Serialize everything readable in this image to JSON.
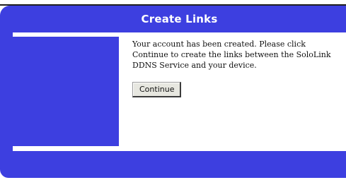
{
  "header": {
    "title": "Create Links"
  },
  "main": {
    "message": "Your account has been created. Please click Continue to create the links between the SoloLink DDNS Service and your device.",
    "continue_label": "Continue"
  },
  "colors": {
    "brand_blue": "#3d3fe0",
    "button_face": "#e7e7e0"
  }
}
